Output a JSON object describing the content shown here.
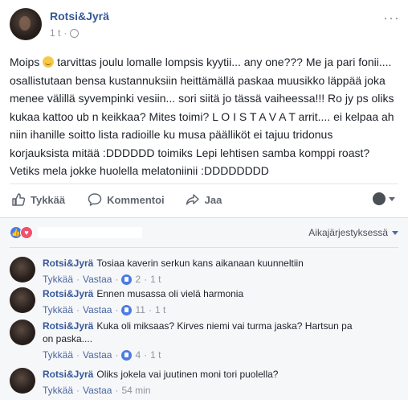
{
  "post": {
    "author": "Rotsi&Jyrä",
    "time": "1 t",
    "separator": "·",
    "more": "···",
    "text_before_emoji": "Moips",
    "text_after_emoji": "tarvittas joulu lomalle lompsis kyytii... any one??? Me ja pari fonii.... osallistutaan bensa kustannuksiin heittämällä paskaa muusikko läppää joka menee välillä syvempinki vesiin... sori siitä jo tässä vaiheessa!!! Ro jy ps oliks kukaa kattoo ub n keikkaa? Mites toimi? L O I S T A V A T arrit.... ei kelpaa ah niin ihanille soitto lista radioille ku musa päälliköt ei tajuu tridonus korjauksista mitää :DDDDDD toimiks Lepi lehtisen samba komppi roast? Vetiks mela jokke huolella melatoniinii :DDDDDDDD"
  },
  "actions": {
    "like": "Tykkää",
    "comment": "Kommentoi",
    "share": "Jaa"
  },
  "comments_section": {
    "sort_label": "Aikajärjestyksessä",
    "comments": [
      {
        "author": "Rotsi&Jyrä",
        "text": "Tosiaa kaverin serkun kans aikanaan kuunneltiin",
        "like": "Tykkää",
        "reply": "Vastaa",
        "likes": "2",
        "time": "1 t"
      },
      {
        "author": "Rotsi&Jyrä",
        "text": "Ennen musassa oli vielä harmonia",
        "like": "Tykkää",
        "reply": "Vastaa",
        "likes": "11",
        "time": "1 t"
      },
      {
        "author": "Rotsi&Jyrä",
        "text": "Kuka oli miksaas? Kirves niemi vai turma jaska? Hartsun pa on paska....",
        "like": "Tykkää",
        "reply": "Vastaa",
        "likes": "4",
        "time": "1 t"
      },
      {
        "author": "Rotsi&Jyrä",
        "text": "Oliks jokela vai juutinen moni tori puolella?",
        "like": "Tykkää",
        "reply": "Vastaa",
        "likes": "",
        "time": "54 min"
      }
    ]
  },
  "colors": {
    "link_blue": "#365899",
    "meta_grey": "#90949c",
    "like_blue": "#4b7be5",
    "love_red": "#f0506e"
  }
}
